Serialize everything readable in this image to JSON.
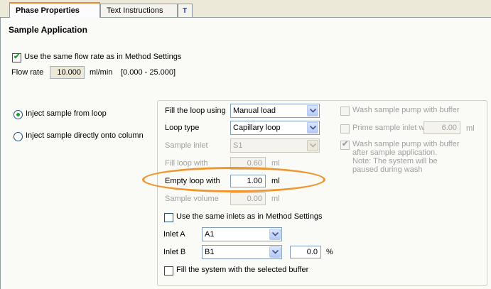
{
  "tabs": [
    {
      "label": "Phase Properties"
    },
    {
      "label": "Text Instructions"
    },
    {
      "label": "T"
    }
  ],
  "section_title": "Sample Application",
  "flow": {
    "same_flow_label": "Use the same flow rate as in Method Settings",
    "flow_rate_label": "Flow rate",
    "flow_rate_value": "10.000",
    "flow_rate_unit": "ml/min",
    "flow_rate_range": "[0.000 - 25.000]"
  },
  "injection": {
    "loop_label": "Inject sample from loop",
    "column_label": "Inject sample directly onto column"
  },
  "loop": {
    "fill_using_label": "Fill the loop using",
    "fill_using_value": "Manual load",
    "loop_type_label": "Loop type",
    "loop_type_value": "Capillary loop",
    "sample_inlet_label": "Sample inlet",
    "sample_inlet_value": "S1",
    "fill_loop_label": "Fill loop with",
    "fill_loop_value": "0.60",
    "fill_loop_unit": "ml",
    "empty_loop_label": "Empty loop with",
    "empty_loop_value": "1.00",
    "empty_loop_unit": "ml",
    "sample_volume_label": "Sample volume",
    "sample_volume_value": "0.00",
    "sample_volume_unit": "ml",
    "same_inlets_label": "Use the same inlets as in Method Settings",
    "inlet_a_label": "Inlet A",
    "inlet_a_value": "A1",
    "inlet_b_label": "Inlet B",
    "inlet_b_value": "B1",
    "inlet_b_percent": "0.0",
    "percent_unit": "%",
    "fill_system_label": "Fill the system with the selected buffer"
  },
  "wash": {
    "wash_pump_label": "Wash sample pump with buffer",
    "prime_label": "Prime sample inlet with",
    "prime_value": "6.00",
    "prime_unit": "ml",
    "wash_after_line1": "Wash sample pump with buffer",
    "wash_after_line2": "after sample application.",
    "wash_after_line3": "Note: The system will be",
    "wash_after_line4": "paused during wash"
  }
}
